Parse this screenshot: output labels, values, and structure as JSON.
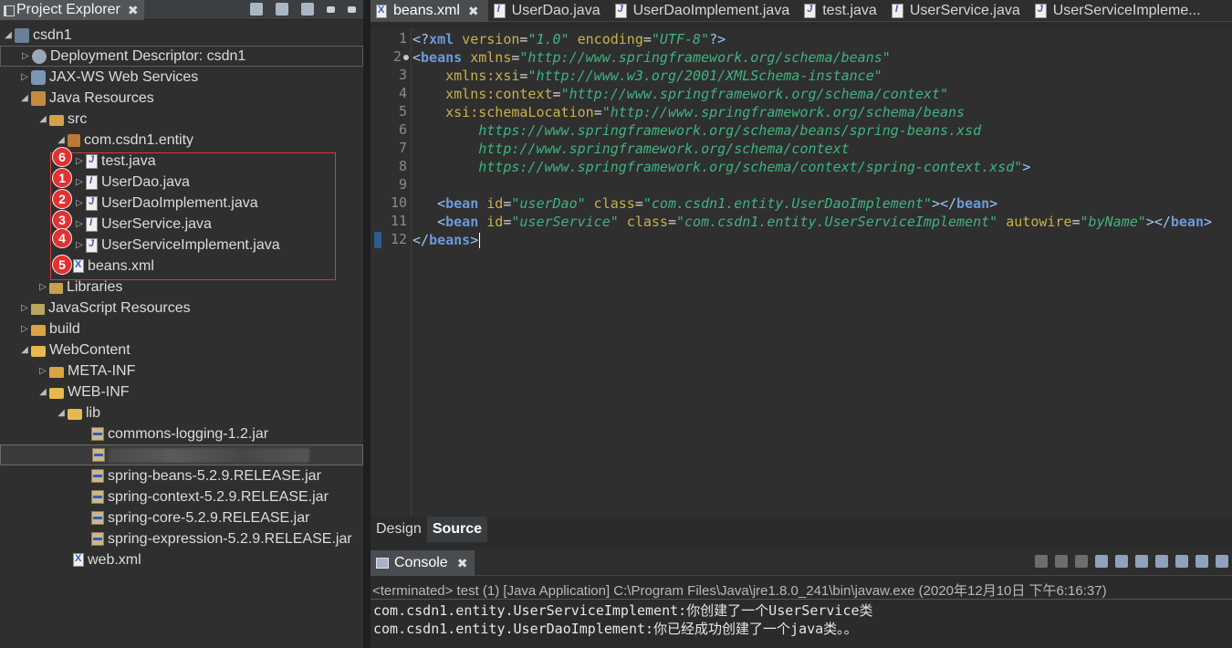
{
  "explorer": {
    "tab_label": "Project Explorer",
    "close_glyph": "✖",
    "items": [
      {
        "label": "csdn1",
        "arrow": "◢",
        "icon": "project-icon"
      },
      {
        "label": "Deployment Descriptor: csdn1",
        "arrow": "▷",
        "icon": "deployment-descriptor-icon"
      },
      {
        "label": "JAX-WS Web Services",
        "arrow": "▷",
        "icon": "web-services-icon"
      },
      {
        "label": "Java Resources",
        "arrow": "◢",
        "icon": "java-resources-icon"
      },
      {
        "label": "src",
        "arrow": "◢",
        "icon": "source-folder-icon"
      },
      {
        "label": "com.csdn1.entity",
        "arrow": "◢",
        "icon": "package-icon"
      },
      {
        "label": "test.java",
        "arrow": "▷",
        "icon": "java-file-icon"
      },
      {
        "label": "UserDao.java",
        "arrow": "▷",
        "icon": "interface-file-icon"
      },
      {
        "label": "UserDaoImplement.java",
        "arrow": "▷",
        "icon": "java-file-icon"
      },
      {
        "label": "UserService.java",
        "arrow": "▷",
        "icon": "interface-file-icon"
      },
      {
        "label": "UserServiceImplement.java",
        "arrow": "▷",
        "icon": "java-file-icon"
      },
      {
        "label": "beans.xml",
        "arrow": "",
        "icon": "xml-file-icon"
      },
      {
        "label": "Libraries",
        "arrow": "▷",
        "icon": "libraries-icon"
      },
      {
        "label": "JavaScript Resources",
        "arrow": "▷",
        "icon": "javascript-resources-icon"
      },
      {
        "label": "build",
        "arrow": "▷",
        "icon": "folder-icon"
      },
      {
        "label": "WebContent",
        "arrow": "◢",
        "icon": "folder-open-icon"
      },
      {
        "label": "META-INF",
        "arrow": "▷",
        "icon": "folder-icon"
      },
      {
        "label": "WEB-INF",
        "arrow": "◢",
        "icon": "folder-open-icon"
      },
      {
        "label": "lib",
        "arrow": "◢",
        "icon": "folder-open-icon"
      },
      {
        "label": "commons-logging-1.2.jar",
        "arrow": "",
        "icon": "jar-icon"
      },
      {
        "label": "",
        "arrow": "",
        "icon": "jar-icon"
      },
      {
        "label": "spring-beans-5.2.9.RELEASE.jar",
        "arrow": "",
        "icon": "jar-icon"
      },
      {
        "label": "spring-context-5.2.9.RELEASE.jar",
        "arrow": "",
        "icon": "jar-icon"
      },
      {
        "label": "spring-core-5.2.9.RELEASE.jar",
        "arrow": "",
        "icon": "jar-icon"
      },
      {
        "label": "spring-expression-5.2.9.RELEASE.jar",
        "arrow": "",
        "icon": "jar-icon"
      },
      {
        "label": "web.xml",
        "arrow": "",
        "icon": "xml-file-icon"
      }
    ],
    "badges": [
      "6",
      "1",
      "2",
      "3",
      "4",
      "5"
    ],
    "annotation_color": "#e23131"
  },
  "editor": {
    "tabs": [
      {
        "label": "beans.xml",
        "icon": "xml-file-icon",
        "close": "✖"
      },
      {
        "label": "UserDao.java",
        "icon": "interface-file-icon"
      },
      {
        "label": "UserDaoImplement.java",
        "icon": "java-file-icon"
      },
      {
        "label": "test.java",
        "icon": "java-file-icon"
      },
      {
        "label": "UserService.java",
        "icon": "interface-file-icon"
      },
      {
        "label": "UserServiceImpleme...",
        "icon": "java-file-icon"
      }
    ],
    "line_numbers": [
      "1",
      "2",
      "3",
      "4",
      "5",
      "6",
      "7",
      "8",
      "9",
      "10",
      "11",
      "12"
    ],
    "code": {
      "l1": {
        "a": "<?",
        "b": "xml",
        "c": " version",
        "d": "=",
        "e": "\"1.0\"",
        "f": " encoding",
        "g": "=",
        "h": "\"UTF-8\"",
        "i": "?>"
      },
      "l2": {
        "a": "<",
        "b": "beans",
        "c": " xmlns",
        "d": "=",
        "e": "\"http://www.springframework.org/schema/beans\""
      },
      "l3": {
        "c": "    xmlns:xsi",
        "d": "=",
        "e": "\"http://www.w3.org/2001/XMLSchema-instance\""
      },
      "l4": {
        "c": "    xmlns:context",
        "d": "=",
        "e": "\"http://www.springframework.org/schema/context\""
      },
      "l5": {
        "c": "    xsi:schemaLocation",
        "d": "=",
        "e": "\"http://www.springframework.org/schema/beans"
      },
      "l6": {
        "e": "        https://www.springframework.org/schema/beans/spring-beans.xsd"
      },
      "l7": {
        "e": "        http://www.springframework.org/schema/context"
      },
      "l8": {
        "e": "        https://www.springframework.org/schema/context/spring-context.xsd\"",
        "i": ">"
      },
      "l10": {
        "a": "   <",
        "b": "bean",
        "c": " id",
        "d": "=",
        "e": "\"userDao\"",
        "f": " class",
        "g": "=",
        "h": "\"com.csdn1.entity.UserDaoImplement\"",
        "i": "></",
        "j": "bean",
        "k": ">"
      },
      "l11": {
        "a": "   <",
        "b": "bean",
        "c": " id",
        "d": "=",
        "e": "\"userService\"",
        "f": " class",
        "g": "=",
        "h": "\"com.csdn1.entity.UserServiceImplement\"",
        "m": " autowire",
        "n": "=",
        "o": "\"byName\"",
        "i": "></",
        "j": "bean",
        "k": ">"
      },
      "l12": {
        "a": "</",
        "b": "beans",
        "i": ">"
      }
    },
    "bottom_tabs": {
      "design": "Design",
      "source": "Source"
    }
  },
  "console": {
    "tab_label": "Console",
    "close_glyph": "✖",
    "status": "<terminated> test (1) [Java Application] C:\\Program Files\\Java\\jre1.8.0_241\\bin\\javaw.exe (2020年12月10日 下午6:16:37)",
    "lines": [
      "com.csdn1.entity.UserServiceImplement:你创建了一个UserService类",
      "com.csdn1.entity.UserDaoImplement:你已经成功创建了一个java类。。"
    ]
  },
  "colors": {
    "xml_tag": "#6b9ad8",
    "xml_attr": "#c8b24b",
    "xml_value": "#3fb37f",
    "background": "#2b2b2b"
  }
}
